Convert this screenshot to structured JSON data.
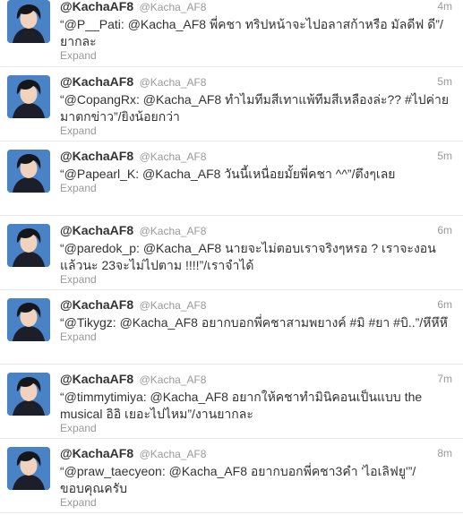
{
  "tweets": [
    {
      "fullname": "@KachaAF8",
      "username": "@Kacha_AF8",
      "time": "4m",
      "text": "“@P__Pati: @Kacha_AF8 พี่คชา ทริปหน้าจะไปอลาสก้าหรือ มัลดีฟ ดี”/ยากละ",
      "expand": "Expand"
    },
    {
      "fullname": "@KachaAF8",
      "username": "@Kacha_AF8",
      "time": "5m",
      "text": "“@CopangRx: @Kacha_AF8 ทำไมทีมสีเทาแพ้ทีมสีเหลืองล่ะ?? #ไปค่ายมาตกข่าว”/ยิงน้อยกว่า",
      "expand": "Expand"
    },
    {
      "fullname": "@KachaAF8",
      "username": "@Kacha_AF8",
      "time": "5m",
      "text": "“@Papearl_K: @Kacha_AF8 วันนี้เหนื่อยมั้ยพี่คชา ^^”/ตึงๆเลย",
      "expand": "Expand"
    },
    {
      "fullname": "@KachaAF8",
      "username": "@Kacha_AF8",
      "time": "6m",
      "text": "“@paredok_p: @Kacha_AF8 นายจะไม่ตอบเราจริงๆหรอ ? เราจะงอนแล้วนะ 23จะไม่ไปตาม !!!!”/เราจำได้",
      "expand": "Expand"
    },
    {
      "fullname": "@KachaAF8",
      "username": "@Kacha_AF8",
      "time": "6m",
      "text": "“@Tikygz: @Kacha_AF8 อยากบอกพี่คชาสามพยางค์ #มิ #ยา #บิ..”/หึหึหึ",
      "expand": "Expand"
    },
    {
      "fullname": "@KachaAF8",
      "username": "@Kacha_AF8",
      "time": "7m",
      "text": "“@timmytimiya: @Kacha_AF8 อยากให้คชาทำมินิคอนเป็นแบบ the musical อิอิ เยอะไปไหม”/งานยากละ",
      "expand": "Expand"
    },
    {
      "fullname": "@KachaAF8",
      "username": "@Kacha_AF8",
      "time": "8m",
      "text": "“@praw_taecyeon: @Kacha_AF8 อยากบอกพี่คชา3คำ 'ไอเลิฟยู'”/ขอบคุณครับ",
      "expand": "Expand"
    }
  ]
}
